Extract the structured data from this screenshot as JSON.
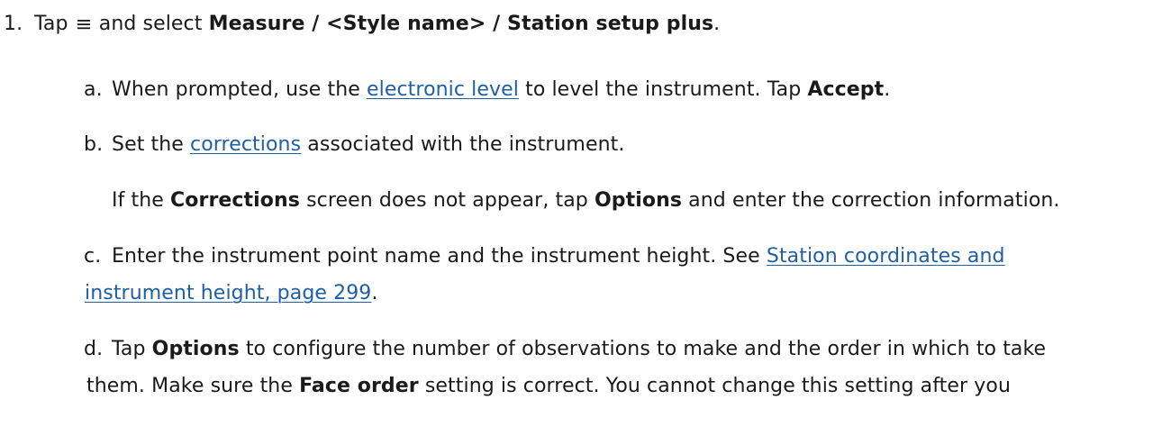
{
  "step": {
    "number": "1.",
    "tap_prefix": "Tap",
    "menu_icon": "hamburger-menu-icon",
    "and_select": "and select",
    "path": "Measure / <Style name> / Station setup plus",
    "end": "."
  },
  "substeps": {
    "a": {
      "letter": "a.",
      "pre": "When prompted, use the",
      "link": "electronic level",
      "post": "to level the instrument. Tap",
      "bold": "Accept",
      "end": "."
    },
    "b": {
      "letter": "b.",
      "pre": "Set the",
      "link": "corrections",
      "post": "associated with the instrument.",
      "note_pre": "If the",
      "note_bold1": "Corrections",
      "note_mid": "screen does not appear, tap",
      "note_bold2": "Options",
      "note_post": "and enter the correction information."
    },
    "c": {
      "letter": "c.",
      "pre": "Enter the instrument point name and the instrument height. See",
      "link_line1": "Station coordinates and",
      "link_line2": "instrument height, page 299",
      "end": "."
    },
    "d": {
      "letter": "d.",
      "pre": "Tap",
      "bold1": "Options",
      "post1": "to configure the number of observations to make and the order in which to take",
      "line2_pre": "them. Make sure the",
      "bold2": "Face order",
      "line2_post": "setting is correct. You cannot change this setting after you"
    }
  }
}
